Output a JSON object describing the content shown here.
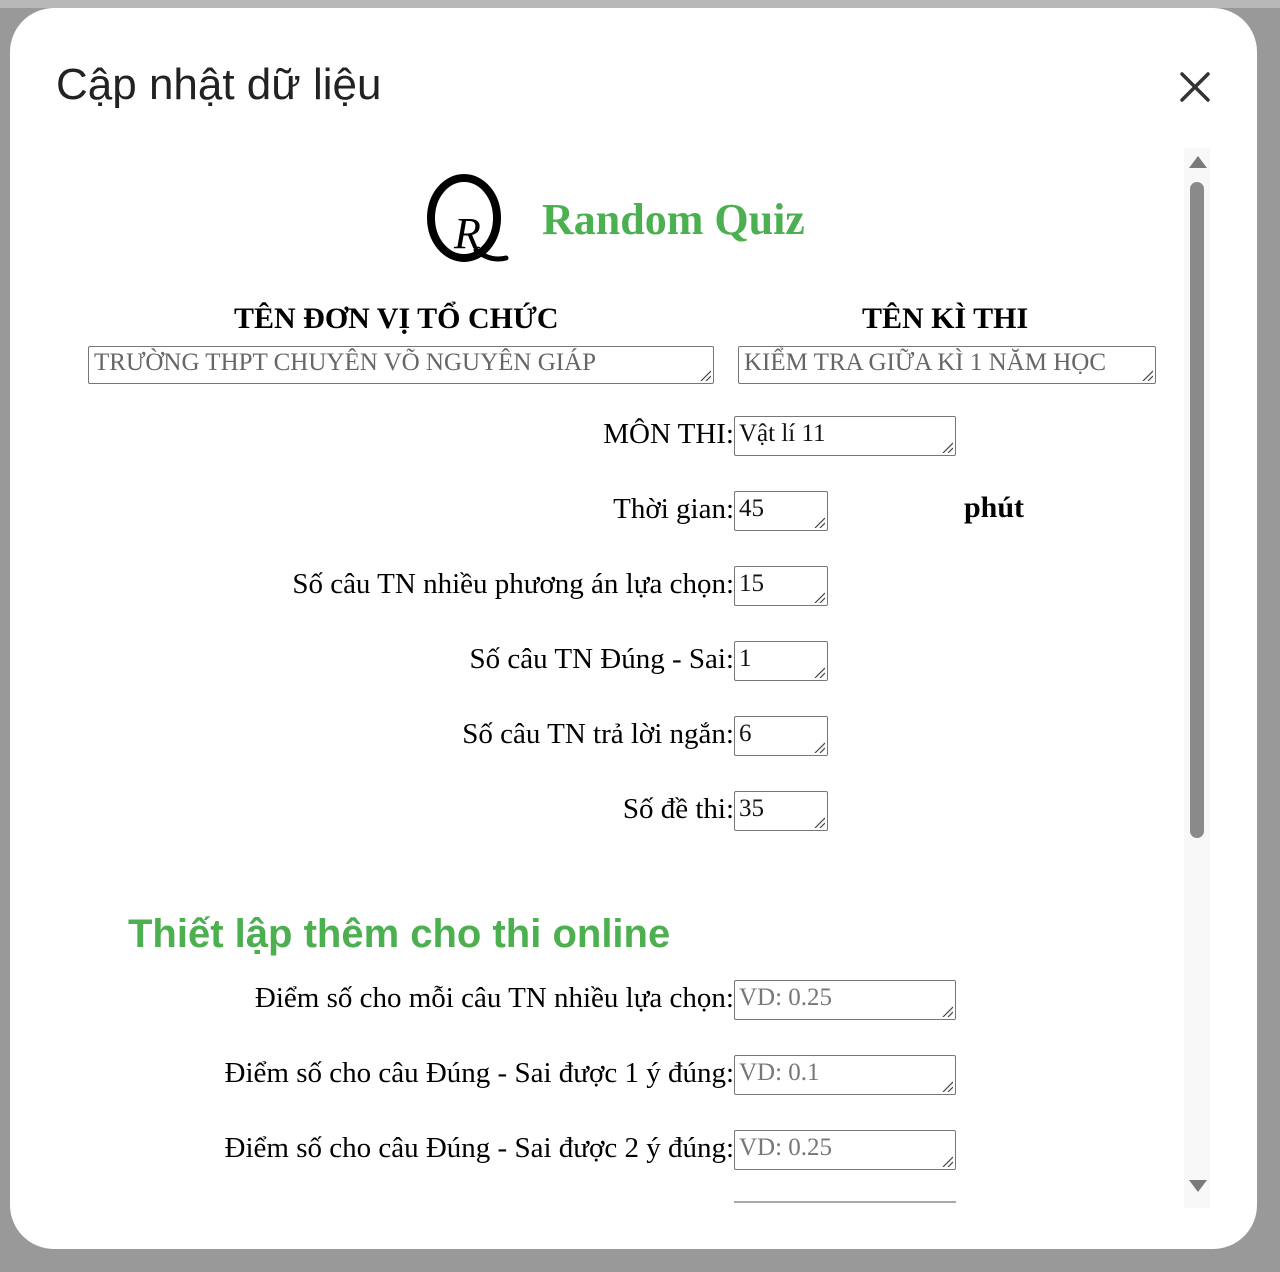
{
  "dialog": {
    "title": "Cập nhật dữ liệu"
  },
  "brand": {
    "name": "Random Quiz",
    "logo_text": "QR",
    "accent_color": "#4caf50"
  },
  "header": {
    "org_heading": "TÊN ĐƠN VỊ TỔ CHỨC",
    "org_value": "TRƯỜNG THPT CHUYÊN VÕ NGUYÊN GIÁP",
    "exam_heading": "TÊN KÌ THI",
    "exam_value": "KIỂM TRA GIỮA KÌ 1 NĂM HỌC"
  },
  "form": {
    "subject": {
      "label": "MÔN THI:",
      "value": "Vật lí 11"
    },
    "time": {
      "label": "Thời gian:",
      "value": "45",
      "unit": "phút"
    },
    "mc_count": {
      "label": "Số câu TN nhiều phương án lựa chọn:",
      "value": "15"
    },
    "tf_count": {
      "label": "Số câu TN Đúng - Sai:",
      "value": "1"
    },
    "short_count": {
      "label": "Số câu TN trả lời ngắn:",
      "value": "6"
    },
    "exam_count": {
      "label": "Số đề thi:",
      "value": "35"
    }
  },
  "online": {
    "title": "Thiết lập thêm cho thi online",
    "mc_score": {
      "label": "Điểm số cho mỗi câu TN nhiều lựa chọn:",
      "placeholder": "VD: 0.25"
    },
    "tf1_score": {
      "label": "Điểm số cho câu Đúng - Sai được 1 ý đúng:",
      "placeholder": "VD: 0.1"
    },
    "tf2_score": {
      "label": "Điểm số cho câu Đúng - Sai được 2 ý đúng:",
      "placeholder": "VD: 0.25"
    }
  }
}
